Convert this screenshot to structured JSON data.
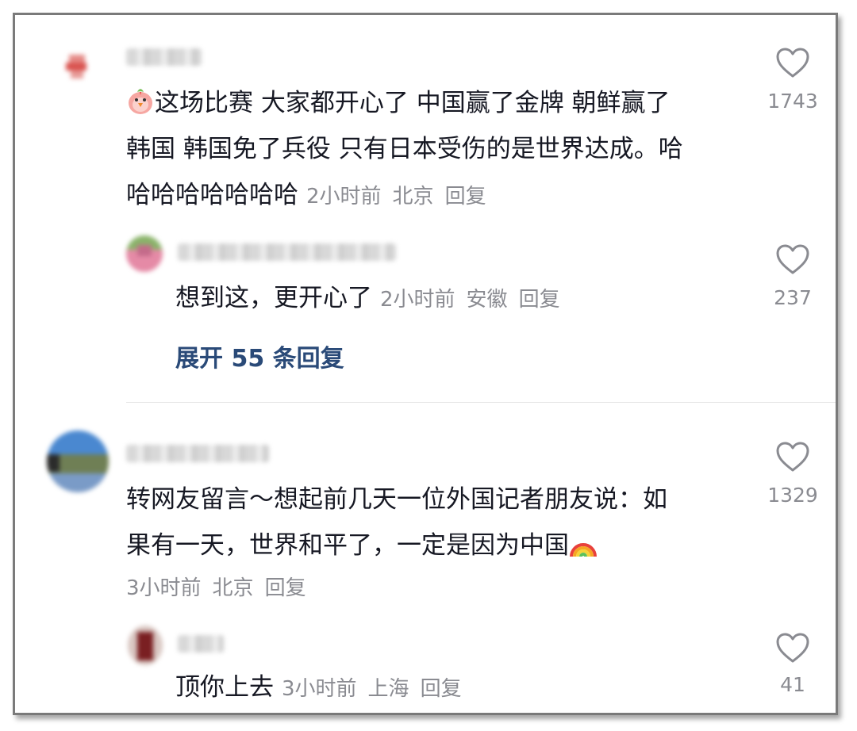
{
  "comments": [
    {
      "text_lines": [
        "这场比赛 大家都开心了 中国赢了金牌 朝鲜赢了",
        "韩国 韩国免了兵役 只有日本受伤的是世界达成。哈",
        "哈哈哈哈哈哈哈"
      ],
      "leading_emoji": "chick-emoji",
      "time": "2小时前",
      "location": "北京",
      "reply_label": "回复",
      "likes": "1743",
      "replies": [
        {
          "text": "想到这，更开心了",
          "time": "2小时前",
          "location": "安徽",
          "reply_label": "回复",
          "likes": "237"
        }
      ],
      "expand_label": "展开 55 条回复"
    },
    {
      "text_lines": [
        "转网友留言～想起前几天一位外国记者朋友说：如",
        "果有一天，世界和平了，一定是因为中国"
      ],
      "trailing_emoji": "rainbow-emoji",
      "time": "3小时前",
      "location": "北京",
      "reply_label": "回复",
      "likes": "1329",
      "replies": [
        {
          "text": "顶你上去",
          "time": "3小时前",
          "location": "上海",
          "reply_label": "回复",
          "likes": "41"
        }
      ]
    }
  ],
  "icons": {
    "like": "heart-outline-icon"
  },
  "colors": {
    "text": "#161823",
    "meta": "#8a8b91",
    "expand_link": "#2a4a78",
    "divider": "#e6e6e6"
  }
}
